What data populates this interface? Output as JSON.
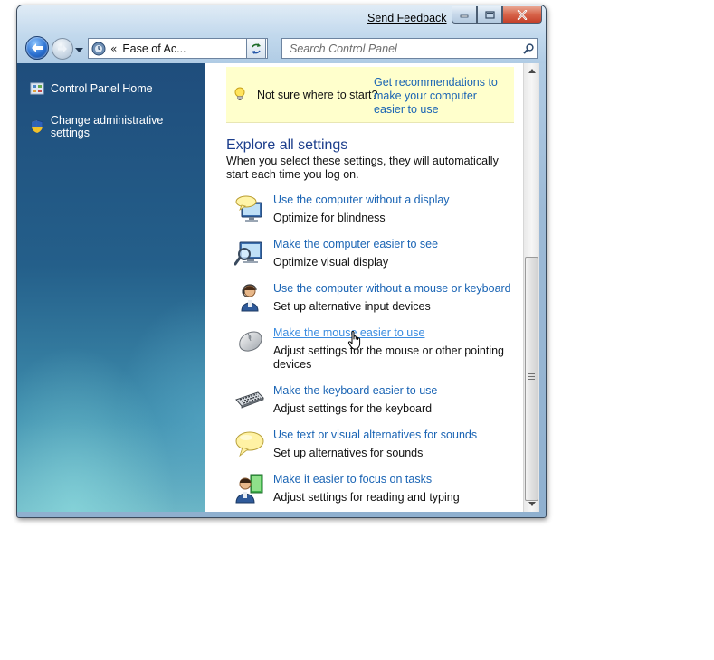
{
  "window": {
    "send_feedback": "Send Feedback",
    "caption_buttons": [
      "minimize",
      "maximize",
      "close"
    ]
  },
  "nav": {
    "back_icon": "back-arrow-icon",
    "forward_icon": "forward-arrow-icon",
    "address_prefix": "«",
    "address_text": "Ease of Ac...",
    "search_placeholder": "Search Control Panel"
  },
  "sidebar": {
    "items": [
      {
        "label": "Control Panel Home",
        "icon": "control-panel-icon"
      },
      {
        "label": "Change administrative settings",
        "icon": "uac-shield-icon"
      }
    ]
  },
  "tip": {
    "label": "Not sure where to start?",
    "link": "Get recommendations to make your computer easier to use",
    "icon": "lightbulb-icon"
  },
  "main": {
    "title": "Explore all settings",
    "description": "When you select these settings, they will automatically start each time you log on.",
    "options": [
      {
        "link": "Use the computer without a display",
        "desc": "Optimize for blindness",
        "icon": "speech-monitor-icon"
      },
      {
        "link": "Make the computer easier to see",
        "desc": "Optimize visual display",
        "icon": "magnifier-monitor-icon"
      },
      {
        "link": "Use the computer without a mouse or keyboard",
        "desc": "Set up alternative input devices",
        "icon": "person-headset-icon"
      },
      {
        "link": "Make the mouse easier to use",
        "desc": "Adjust settings for the mouse or other pointing devices",
        "icon": "mouse-icon",
        "hovered": true
      },
      {
        "link": "Make the keyboard easier to use",
        "desc": "Adjust settings for the keyboard",
        "icon": "keyboard-icon"
      },
      {
        "link": "Use text or visual alternatives for sounds",
        "desc": "Set up alternatives for sounds",
        "icon": "speech-bubble-icon"
      },
      {
        "link": "Make it easier to focus on tasks",
        "desc": "Adjust settings for reading and typing",
        "icon": "person-document-icon"
      }
    ]
  },
  "colors": {
    "link": "#1a64b4",
    "link_hover": "#3b8ce0",
    "title": "#1c3e8c",
    "tip_background": "#ffffcc",
    "sidebar_top": "#1f4d7c",
    "sidebar_bottom": "#6fb8c6"
  }
}
